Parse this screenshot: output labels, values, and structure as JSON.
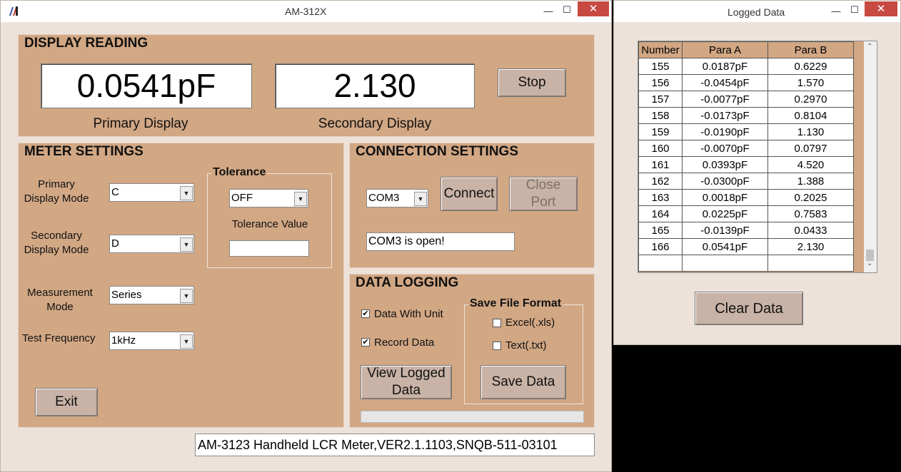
{
  "main_window": {
    "title": "AM-312X",
    "minimize": "—",
    "maximize": "☐",
    "close": "✕"
  },
  "display_reading": {
    "title": "DISPLAY READING",
    "primary_value": "0.0541pF",
    "primary_label": "Primary Display",
    "secondary_value": "2.130",
    "secondary_label": "Secondary Display",
    "stop_button": "Stop"
  },
  "meter_settings": {
    "title": "METER SETTINGS",
    "primary_mode_label": "Primary\nDisplay Mode",
    "primary_mode_value": "C",
    "secondary_mode_label": "Secondary\nDisplay Mode",
    "secondary_mode_value": "D",
    "measurement_mode_label": "Measurement\nMode",
    "measurement_mode_value": "Series",
    "test_frequency_label": "Test Frequency",
    "test_frequency_value": "1kHz",
    "tolerance_title": "Tolerance",
    "tolerance_value": "OFF",
    "tolerance_value_label": "Tolerance Value",
    "tolerance_input": "",
    "exit_button": "Exit"
  },
  "connection_settings": {
    "title": "CONNECTION SETTINGS",
    "port": "COM3",
    "connect_button": "Connect",
    "close_port_button": "Close\nPort",
    "status": "COM3 is open!"
  },
  "data_logging": {
    "title": "DATA LOGGING",
    "data_with_unit_label": "Data With Unit",
    "data_with_unit_checked": true,
    "record_data_label": "Record Data",
    "record_data_checked": true,
    "view_logged_button": "View Logged\nData",
    "save_format_title": "Save File Format",
    "excel_label": "Excel(.xls)",
    "excel_checked": false,
    "text_label": "Text(.txt)",
    "text_checked": false,
    "save_data_button": "Save Data",
    "progress": 0
  },
  "status_bar": "AM-3123 Handheld LCR Meter,VER2.1.1103,SNQB-511-03101",
  "logged_window": {
    "title": "Logged Data",
    "minimize": "—",
    "maximize": "☐",
    "close": "✕",
    "columns": [
      "Number",
      "Para A",
      "Para B"
    ],
    "rows": [
      [
        "155",
        "0.0187pF",
        "0.6229"
      ],
      [
        "156",
        "-0.0454pF",
        "1.570"
      ],
      [
        "157",
        "-0.0077pF",
        "0.2970"
      ],
      [
        "158",
        "-0.0173pF",
        "0.8104"
      ],
      [
        "159",
        "-0.0190pF",
        "1.130"
      ],
      [
        "160",
        "-0.0070pF",
        "0.0797"
      ],
      [
        "161",
        "0.0393pF",
        "4.520"
      ],
      [
        "162",
        "-0.0300pF",
        "1.388"
      ],
      [
        "163",
        "0.0018pF",
        "0.2025"
      ],
      [
        "164",
        "0.0225pF",
        "0.7583"
      ],
      [
        "165",
        "-0.0139pF",
        "0.0433"
      ],
      [
        "166",
        "0.0541pF",
        "2.130"
      ]
    ],
    "clear_button": "Clear Data"
  }
}
